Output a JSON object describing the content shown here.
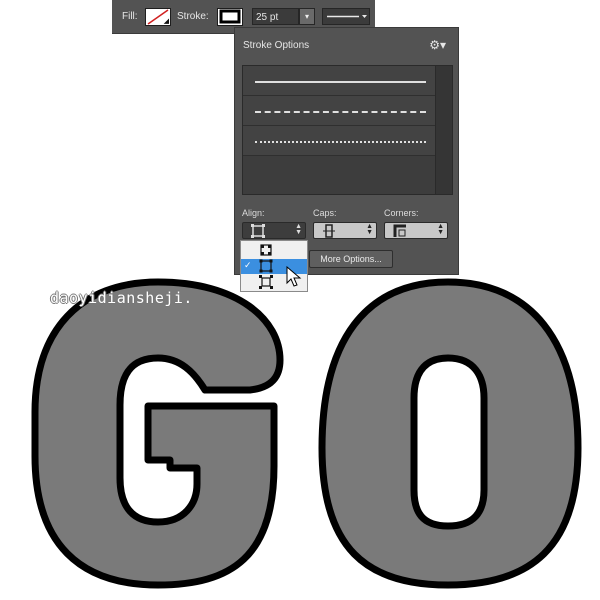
{
  "options_bar": {
    "fill_label": "Fill:",
    "stroke_label": "Stroke:",
    "stroke_width": "25 pt"
  },
  "stroke_panel": {
    "title": "Stroke Options",
    "line_styles": [
      "solid",
      "dashed",
      "dotted"
    ],
    "align_label": "Align:",
    "caps_label": "Caps:",
    "corners_label": "Corners:",
    "more_options_label": "More Options...",
    "align_menu": {
      "options": [
        "inside",
        "center",
        "outside"
      ],
      "selected": "center",
      "check_glyph": "✓"
    }
  },
  "watermark": "daoyidiansheji.",
  "artwork": {
    "letters": [
      "G",
      "O"
    ],
    "fill_color": "#7a7a7a",
    "stroke_color": "#000000"
  },
  "colors": {
    "panel_bg": "#535353",
    "menu_highlight": "#3b8fe0"
  }
}
